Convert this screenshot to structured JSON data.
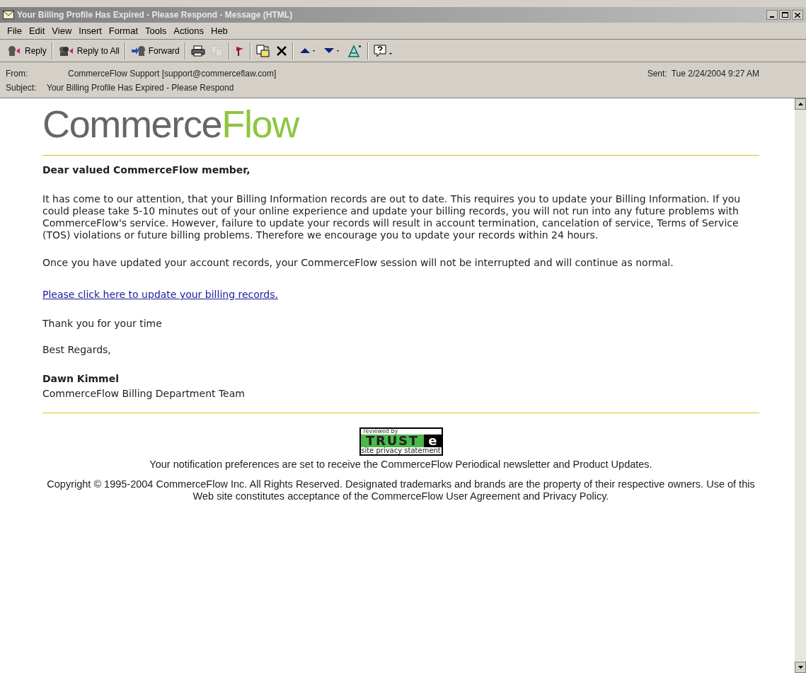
{
  "window": {
    "title": "Your Billing Profile Has Expired - Please Respond - Message (HTML)"
  },
  "menu": [
    "File",
    "Edit",
    "View",
    "Insert",
    "Format",
    "Tools",
    "Actions",
    "Heb"
  ],
  "toolbar": [
    {
      "kind": "reply",
      "label": "Reply"
    },
    {
      "kind": "replyall",
      "label": "Reply to All"
    },
    {
      "kind": "forward",
      "label": "Forward"
    },
    {
      "kind": "print"
    },
    {
      "kind": "copy",
      "disabled": true
    },
    {
      "kind": "flag"
    },
    {
      "kind": "move"
    },
    {
      "kind": "delete"
    },
    {
      "kind": "up"
    },
    {
      "kind": "down"
    },
    {
      "kind": "address"
    },
    {
      "kind": "help"
    }
  ],
  "header": {
    "from_label": "From:",
    "from": "CommerceFlow Support [support@commerceflaw.com]",
    "sent_label": "Sent:",
    "sent": "Tue 2/24/2004 9:27 AM",
    "subject_label": "Subject:",
    "subject": "Your Billing Profile Has Expired - Please Respond"
  },
  "message": {
    "logo": {
      "dark": "Commerce",
      "accent": "Flow"
    },
    "greeting": "Dear valued CommerceFlow member,",
    "paragraphs": [
      "It has come to our attention, that your Billing Information records are out to date. This requires you to update your Billing Information. If you could please take 5-10 minutes out of your online experience and update your billing records, you will not run into any future problems with CommerceFlow's service. However, failure to update your records will result in account termination, cancelation of service, Terms of Service (TOS) violations or future billing problems. Therefore we encourage you to update your records within 24 hours.",
      "Once you have updated your account records, your CommerceFlow session will not be interrupted and will continue as normal."
    ],
    "link": "Please click here to update your billing records.",
    "thanks": "Thank you for your time",
    "regards": "Best Regards,",
    "signer": "Dawn Kimmel",
    "team": "CommerceFlow Billing Department Team",
    "badge": {
      "top": "reviewed by",
      "main": "TRUST",
      "mark": "e",
      "bottom": "site privacy statement"
    },
    "notice": "Your notification preferences are set to receive the CommerceFlow Periodical newsletter and Product Updates.",
    "copyright": "Copyright © 1995-2004 CommerceFlow Inc. All Rights Reserved. Designated trademarks and brands are the property of their respective owners. Use of this Web site constitutes acceptance of the CommerceFlow User Agreement and Privacy Policy."
  }
}
